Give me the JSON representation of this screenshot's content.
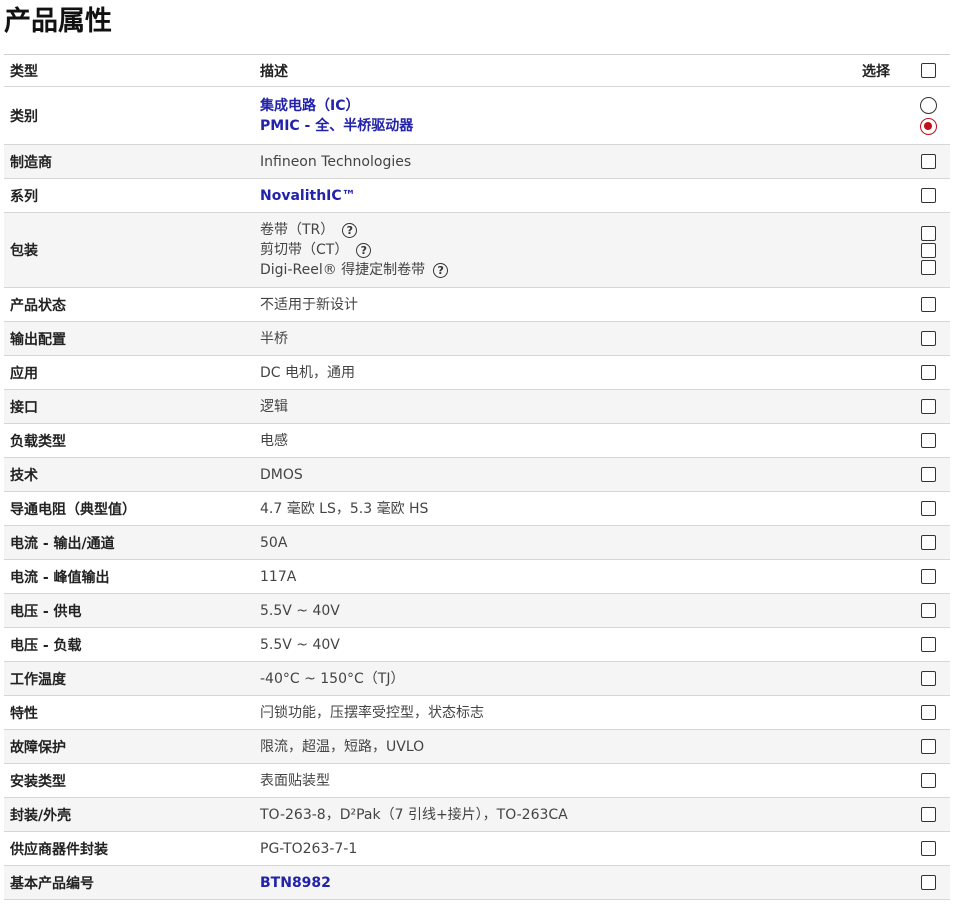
{
  "page": {
    "title": "产品属性"
  },
  "header": {
    "type": "类型",
    "description": "描述",
    "select": "选择"
  },
  "rows": [
    {
      "type": "类别",
      "lines": [
        {
          "text": "集成电路（IC）",
          "link": true
        },
        {
          "text": "PMIC - 全、半桥驱动器",
          "link": true
        }
      ],
      "selector": "radio",
      "radio_states": [
        "unchecked",
        "checked"
      ]
    },
    {
      "type": "制造商",
      "lines": [
        {
          "text": "Infineon Technologies"
        }
      ],
      "selector": "checkbox"
    },
    {
      "type": "系列",
      "lines": [
        {
          "text": "NovalithIC™",
          "link": true
        }
      ],
      "selector": "checkbox"
    },
    {
      "type": "包装",
      "lines": [
        {
          "text": "卷带（TR）",
          "help": true
        },
        {
          "text": "剪切带（CT）",
          "help": true
        },
        {
          "text": "Digi-Reel® 得捷定制卷带",
          "help": true
        }
      ],
      "selector": "checkbox-multi"
    },
    {
      "type": "产品状态",
      "lines": [
        {
          "text": "不适用于新设计"
        }
      ],
      "selector": "checkbox"
    },
    {
      "type": "输出配置",
      "lines": [
        {
          "text": "半桥"
        }
      ],
      "selector": "checkbox"
    },
    {
      "type": "应用",
      "lines": [
        {
          "text": "DC 电机，通用"
        }
      ],
      "selector": "checkbox"
    },
    {
      "type": "接口",
      "lines": [
        {
          "text": "逻辑"
        }
      ],
      "selector": "checkbox"
    },
    {
      "type": "负载类型",
      "lines": [
        {
          "text": "电感"
        }
      ],
      "selector": "checkbox"
    },
    {
      "type": "技术",
      "lines": [
        {
          "text": "DMOS"
        }
      ],
      "selector": "checkbox"
    },
    {
      "type": "导通电阻（典型值）",
      "lines": [
        {
          "text": "4.7 毫欧 LS，5.3 毫欧 HS"
        }
      ],
      "selector": "checkbox"
    },
    {
      "type": "电流 - 输出/通道",
      "lines": [
        {
          "text": "50A"
        }
      ],
      "selector": "checkbox"
    },
    {
      "type": "电流 - 峰值输出",
      "lines": [
        {
          "text": "117A"
        }
      ],
      "selector": "checkbox"
    },
    {
      "type": "电压 - 供电",
      "lines": [
        {
          "text": "5.5V ~ 40V"
        }
      ],
      "selector": "checkbox"
    },
    {
      "type": "电压 - 负载",
      "lines": [
        {
          "text": "5.5V ~ 40V"
        }
      ],
      "selector": "checkbox"
    },
    {
      "type": "工作温度",
      "lines": [
        {
          "text": "-40°C ~ 150°C（TJ）"
        }
      ],
      "selector": "checkbox"
    },
    {
      "type": "特性",
      "lines": [
        {
          "text": "闩锁功能，压摆率受控型，状态标志"
        }
      ],
      "selector": "checkbox"
    },
    {
      "type": "故障保护",
      "lines": [
        {
          "text": "限流，超温，短路，UVLO"
        }
      ],
      "selector": "checkbox"
    },
    {
      "type": "安装类型",
      "lines": [
        {
          "text": "表面贴装型"
        }
      ],
      "selector": "checkbox"
    },
    {
      "type": "封装/外壳",
      "lines": [
        {
          "text": "TO-263-8，D²Pak（7 引线+接片），TO-263CA"
        }
      ],
      "selector": "checkbox"
    },
    {
      "type": "供应商器件封装",
      "lines": [
        {
          "text": "PG-TO263-7-1"
        }
      ],
      "selector": "checkbox"
    },
    {
      "type": "基本产品编号",
      "lines": [
        {
          "text": "BTN8982",
          "link": true
        }
      ],
      "selector": "checkbox"
    }
  ],
  "icons": {
    "help": "help-circle-icon",
    "help_glyph": "?"
  },
  "colors": {
    "link": "#2222aa",
    "radio_checked": "#c0121a",
    "alt_row": "#f5f5f5"
  }
}
